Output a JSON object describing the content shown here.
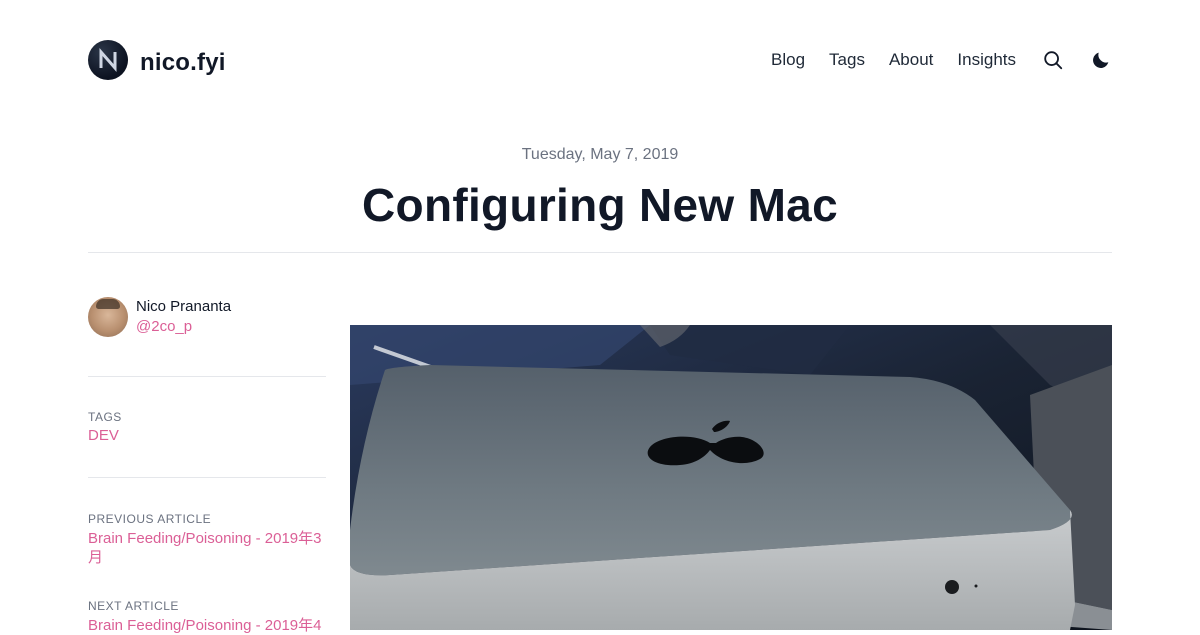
{
  "site": {
    "name": "nico.fyi",
    "logo_icon": "n-monogram-icon"
  },
  "nav": {
    "items": [
      {
        "label": "Blog"
      },
      {
        "label": "Tags"
      },
      {
        "label": "About"
      },
      {
        "label": "Insights"
      }
    ],
    "search_icon": "search-icon",
    "theme_icon": "moon-icon"
  },
  "post": {
    "date": "Tuesday, May 7, 2019",
    "title": "Configuring New Mac"
  },
  "author": {
    "name": "Nico Prananta",
    "handle": "@2co_p"
  },
  "tags": {
    "label": "TAGS",
    "items": [
      "DEV"
    ]
  },
  "previous": {
    "label": "PREVIOUS ARTICLE",
    "title": "Brain Feeding/Poisoning - 2019年3月"
  },
  "next": {
    "label": "NEXT ARTICLE",
    "title": "Brain Feeding/Poisoning - 2019年4"
  },
  "colors": {
    "accent": "#db5f96",
    "text": "#111827",
    "muted": "#6b7280",
    "border": "#e5e7eb"
  }
}
